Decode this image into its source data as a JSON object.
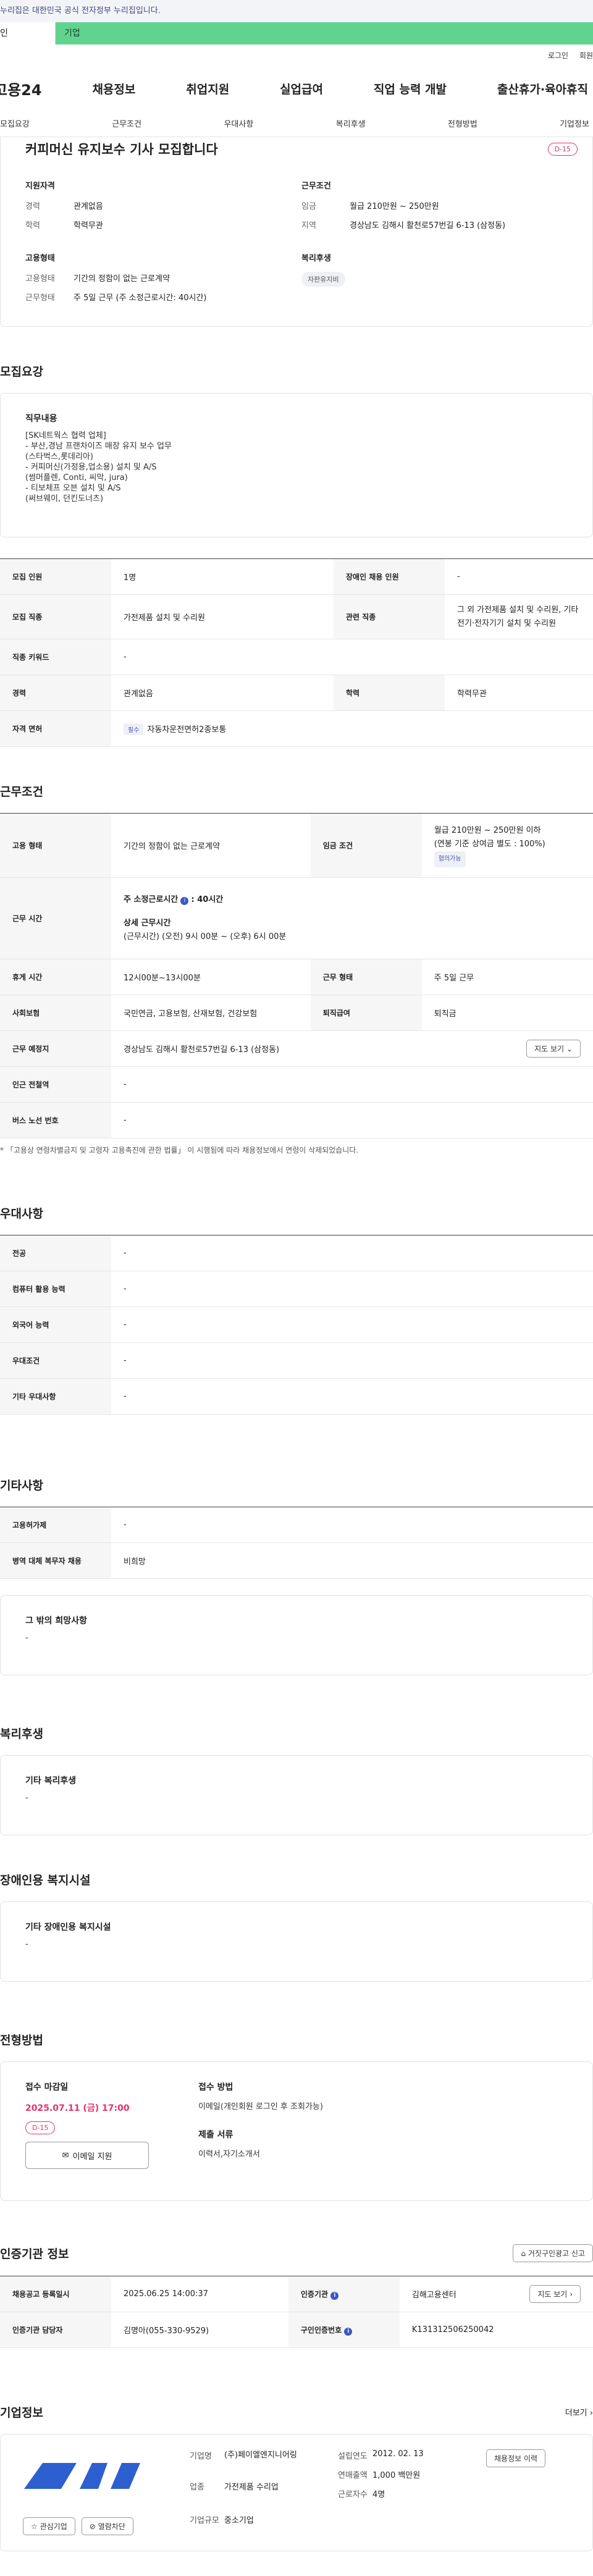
{
  "top_notice": "누리집은 대한민국 공식 전자정부 누리집입니다.",
  "tabs": {
    "person": "인",
    "company": "기업"
  },
  "util": {
    "login": "로그인",
    "join": "회원"
  },
  "gnb": {
    "logo": "고용24",
    "items": [
      "채용정보",
      "취업지원",
      "실업급여",
      "직업 능력 개발",
      "출산휴가·육아휴직"
    ]
  },
  "subnav": [
    "모집요강",
    "근무조건",
    "우대사항",
    "복리후생",
    "전형방법",
    "기업정보"
  ],
  "summary": {
    "title": "커피머신 유지보수 기사 모집합니다",
    "dday": "D-15",
    "qual_title": "지원자격",
    "career_k": "경력",
    "career_v": "관계없음",
    "edu_k": "학력",
    "edu_v": "학력무관",
    "cond_title": "근무조건",
    "wage_k": "임금",
    "wage_v": "월급 210만원 ~ 250만원",
    "area_k": "지역",
    "area_v": "경상남도 김해시 활천로57번길 6-13 (삼정동)",
    "emp_title": "고용형태",
    "emptype_k": "고용형태",
    "emptype_v": "기간의 정함이 없는 근로계약",
    "worktype_k": "근무형태",
    "worktype_v": "주 5일 근무 (주 소정근로시간: 40시간)",
    "welfare_title": "복리후생",
    "welfare_chip": "자판유지비"
  },
  "recruit": {
    "title": "모집요강",
    "job_title": "직무내용",
    "job_body": "[SK네트웍스 협력 업체]\n- 부산,경남 프랜차이즈 매장 유지 보수 업무\n  (스타벅스,롯데리아)\n- 커피머신(가정용,업소용) 설치 및 A/S\n  (썸머플렌, Conti, 씨막, jura)\n- 티보체프 오븐 설치 및 A/S\n  (써브웨이, 던킨도너츠)",
    "rows": {
      "count_k": "모집 인원",
      "count_v": "1명",
      "disabled_k": "장애인 채용 인원",
      "disabled_v": "-",
      "job_k": "모집 직종",
      "job_v": "가전제품 설치 및 수리원",
      "rel_k": "관련 직종",
      "rel_v": "그 외 가전제품 설치 및 수리원, 기타 전기·전자기기 설치 및 수리원",
      "kw_k": "직종 키워드",
      "kw_v": "-",
      "career_k": "경력",
      "career_v": "관계없음",
      "edu_k": "학력",
      "edu_v": "학력무관",
      "lic_k": "자격 면허",
      "lic_tag": "필수",
      "lic_v": "자동차운전면허2종보통"
    }
  },
  "work": {
    "title": "근무조건",
    "emp_k": "고용 형태",
    "emp_v": "기간의 정함이 없는 근로계약",
    "wage_k": "임금 조건",
    "wage_v1": "월급 210만원 ~ 250만원 이하",
    "wage_v2": "(연봉 기준 상여금 별도 : 100%)",
    "wage_tag": "협의가능",
    "time_k": "근무 시간",
    "time_main": "주 소정근로시간",
    "time_hours": ": 40시간",
    "time_detail_t": "상세 근무시간",
    "time_detail": "(근무시간) (오전) 9시 00분 ~ (오후) 6시 00분",
    "rest_k": "휴게 시간",
    "rest_v": "12시00분~13시00분",
    "form_k": "근무 형태",
    "form_v": "주 5일 근무",
    "ins_k": "사회보험",
    "ins_v": "국민연금, 고용보험, 산재보험, 건강보험",
    "ret_k": "퇴직급여",
    "ret_v": "퇴직금",
    "place_k": "근무 예정지",
    "place_v": "경상남도 김해시 활천로57번길 6-13 (삼정동)",
    "map_btn": "지도 보기",
    "subway_k": "인근 전철역",
    "subway_v": "-",
    "bus_k": "버스 노선 번호",
    "bus_v": "-",
    "note": "* 「고용상 연령차별금지 및 고령자 고용촉진에 관한 법률」 이 시행됨에 따라 채용정보에서 연령이 삭제되었습니다."
  },
  "pref": {
    "title": "우대사항",
    "rows": [
      {
        "k": "전공",
        "v": "-"
      },
      {
        "k": "컴퓨터 활용 능력",
        "v": "-"
      },
      {
        "k": "외국어 능력",
        "v": "-"
      },
      {
        "k": "우대조건",
        "v": "-"
      },
      {
        "k": "기타 우대사항",
        "v": "-"
      }
    ]
  },
  "etc": {
    "title": "기타사항",
    "rows": [
      {
        "k": "고용허가제",
        "v": "-"
      },
      {
        "k": "병역 대체 복무자 채용",
        "v": "비희망"
      }
    ],
    "box_title": "그 밖의 희망사항",
    "box_v": "-"
  },
  "welfare": {
    "title": "복리후생",
    "box_title": "기타 복리후생",
    "box_v": "-"
  },
  "disabled": {
    "title": "장애인용 복지시설",
    "box_title": "기타 장애인용 복지시설",
    "box_v": "-"
  },
  "apply": {
    "title": "전형방법",
    "deadline_t": "접수 마감일",
    "deadline_v": "2025.07.11 (금) 17:00",
    "dday": "D-15",
    "email_btn": "이메일 지원",
    "method_t": "접수 방법",
    "method_v": "이메일(개인회원 로그인 후 조회가능)",
    "docs_t": "제출 서류",
    "docs_v": "이력서,자기소개서"
  },
  "cert": {
    "title": "인증기관 정보",
    "report_btn": "거짓구인광고 신고",
    "reg_k": "채용공고 등록일시",
    "reg_v": "2025.06.25 14:00:37",
    "agency_k": "인증기관",
    "agency_v": "김해고용센터",
    "map_btn": "지도 보기",
    "mgr_k": "인증기관 담당자",
    "mgr_v": "김명아(055-330-9529)",
    "no_k": "구인인증번호",
    "no_v": "K131312506250042"
  },
  "company": {
    "title": "기업정보",
    "more": "더보기",
    "name_k": "기업명",
    "name_v": "(주)페이엘엔지니어링",
    "est_k": "설립연도",
    "est_v": "2012. 02. 13",
    "sales_k": "연매출액",
    "sales_v": "1,000 백만원",
    "ind_k": "업종",
    "ind_v": "가전제품 수리업",
    "emp_k": "근로자수",
    "emp_v": "4명",
    "size_k": "기업규모",
    "size_v": "중소기업",
    "jobs_btn": "채용정보 이력",
    "fav_btn": "관심기업",
    "block_btn": "열람차단"
  },
  "colors": {
    "accent_green": "#60d48f",
    "dday": "#e2336b",
    "logo_blue": "#2d5fd1"
  }
}
